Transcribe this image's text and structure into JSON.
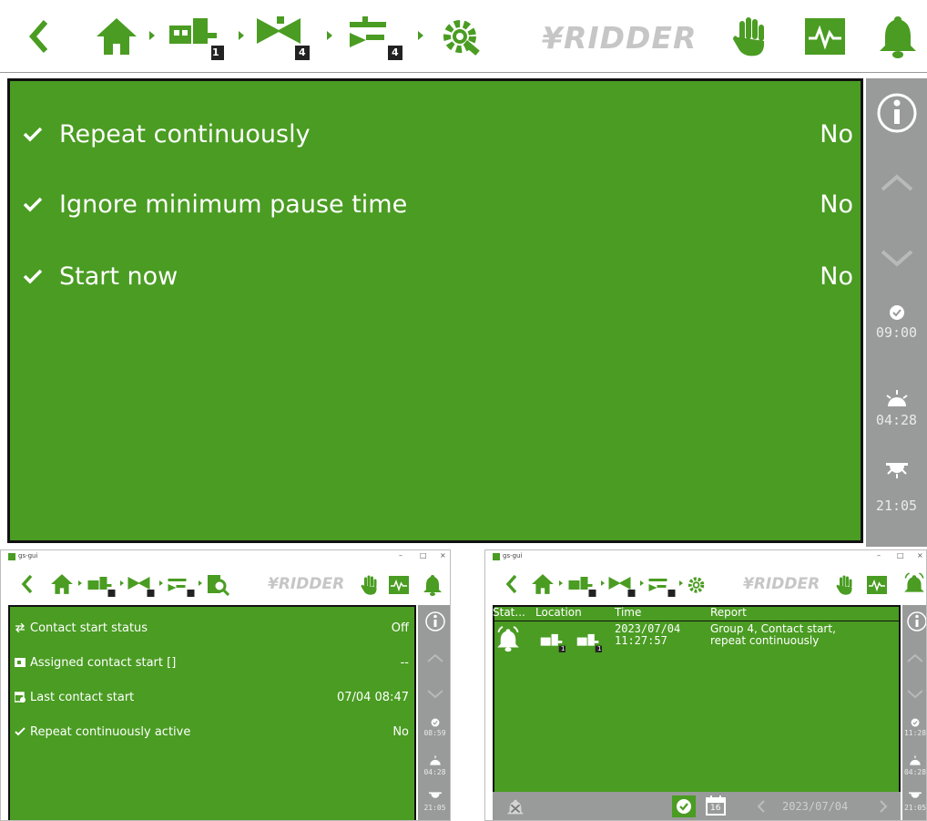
{
  "main": {
    "logo": "¥RIDDER",
    "group_badges": [
      "1",
      "4",
      "4"
    ],
    "rows": [
      {
        "label": "Repeat continuously",
        "value": "No"
      },
      {
        "label": "Ignore minimum pause time",
        "value": "No"
      },
      {
        "label": "Start now",
        "value": "No"
      }
    ],
    "side": {
      "time_now": "09:00",
      "sunrise": "04:28",
      "sunset": "21:05"
    }
  },
  "window_a": {
    "title": "gs-gui",
    "logo": "¥RIDDER",
    "group_badges": [
      "1",
      "4",
      "4"
    ],
    "rows": [
      {
        "label": "Contact start status",
        "value": "Off"
      },
      {
        "label": "Assigned contact start []",
        "value": "--"
      },
      {
        "label": "Last contact start",
        "value": "07/04 08:47"
      },
      {
        "label": "Repeat continuously active",
        "value": "No"
      }
    ],
    "side": {
      "time_now": "08:59",
      "sunrise": "04:28",
      "sunset": "21:05"
    }
  },
  "window_b": {
    "title": "gs-gui",
    "logo": "¥RIDDER",
    "group_badges": [
      "1",
      "4",
      "4"
    ],
    "columns": [
      "Stat...",
      "Location",
      "Time",
      "Report"
    ],
    "alarm_rows": [
      {
        "location_badges": [
          "1",
          "1"
        ],
        "date": "2023/07/04",
        "time": "11:27:57",
        "report_line1": "Group 4, Contact start,",
        "report_line2": "repeat continuously"
      }
    ],
    "bottom": {
      "calendar_day": "16",
      "date": "2023/07/04"
    },
    "side": {
      "time_now": "11:28",
      "sunrise": "04:28",
      "sunset": "21:05"
    }
  },
  "colors": {
    "accent": "#4a9c22",
    "sidebar": "#999a9a",
    "panel_border": "#111111"
  }
}
